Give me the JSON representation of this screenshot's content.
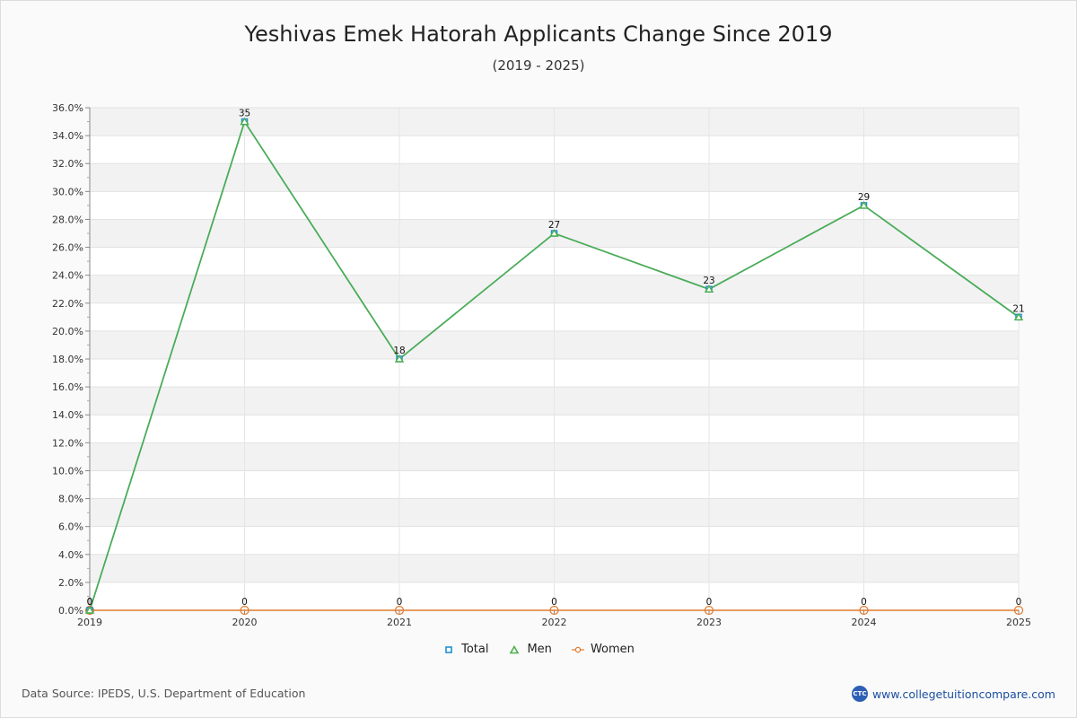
{
  "chart_data": {
    "type": "line",
    "title": "Yeshivas Emek Hatorah Applicants Change Since 2019",
    "subtitle": "(2019 - 2025)",
    "x": [
      "2019",
      "2020",
      "2021",
      "2022",
      "2023",
      "2024",
      "2025"
    ],
    "ylim": [
      0,
      36
    ],
    "ytick_step": 2,
    "ytick_format": "percent_1dp",
    "grid": true,
    "legend_position": "bottom-center",
    "series": [
      {
        "name": "Total",
        "values": [
          0,
          35,
          18,
          27,
          23,
          29,
          21
        ],
        "labels": [
          "0",
          "35",
          "18",
          "27",
          "23",
          "29",
          "21"
        ],
        "color": "#1f8fd0",
        "marker": "square"
      },
      {
        "name": "Men",
        "values": [
          0,
          35,
          18,
          27,
          23,
          29,
          21
        ],
        "labels": [
          "0",
          "35",
          "18",
          "27",
          "23",
          "29",
          "21"
        ],
        "color": "#4cae4c",
        "marker": "triangle"
      },
      {
        "name": "Women",
        "values": [
          0,
          0,
          0,
          0,
          0,
          0,
          0
        ],
        "labels": [
          "0",
          "0",
          "0",
          "0",
          "0",
          "0",
          "0"
        ],
        "color": "#e07a2e",
        "marker": "circle"
      }
    ]
  },
  "footer": {
    "source": "Data Source: IPEDS, U.S. Department of Education",
    "brand_logo": "CTC",
    "brand": "www.collegetuitioncompare.com"
  }
}
